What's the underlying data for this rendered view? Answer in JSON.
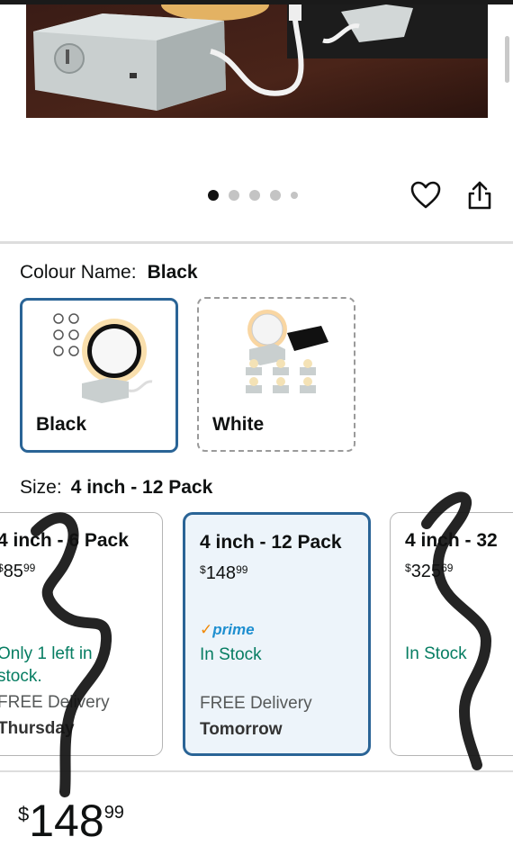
{
  "gallery": {
    "dot_count": 5,
    "active_index": 0
  },
  "colour": {
    "label": "Colour Name:",
    "value": "Black",
    "options": [
      {
        "name": "Black",
        "selected": true
      },
      {
        "name": "White",
        "selected": false
      }
    ]
  },
  "size": {
    "label": "Size:",
    "value": "4 inch - 12 Pack",
    "options": [
      {
        "title": "4 inch - 6 Pack",
        "price_currency": "$",
        "price_whole": "85",
        "price_fraction": "99",
        "stock_line1": "Only 1 left in",
        "stock_line2": "stock.",
        "delivery": "FREE Delivery",
        "delivery_day": "Thursday"
      },
      {
        "title": "4 inch - 12 Pack",
        "price_currency": "$",
        "price_whole": "148",
        "price_fraction": "99",
        "prime": "prime",
        "stock": "In Stock",
        "delivery": "FREE Delivery",
        "delivery_day": "Tomorrow",
        "selected": true
      },
      {
        "title": "4 inch - 32",
        "price_currency": "$",
        "price_whole": "325",
        "price_fraction": "69",
        "stock": "In Stock"
      }
    ]
  },
  "price": {
    "currency": "$",
    "whole": "148",
    "fraction": "99"
  },
  "colors": {
    "selected_border": "#2a6496",
    "selected_bg": "#edf4fa",
    "in_stock": "#067d62",
    "prime_blue": "#1f8fd0",
    "prime_check": "#f08804"
  },
  "icons": {
    "favorite": "heart-icon",
    "share": "share-icon"
  }
}
